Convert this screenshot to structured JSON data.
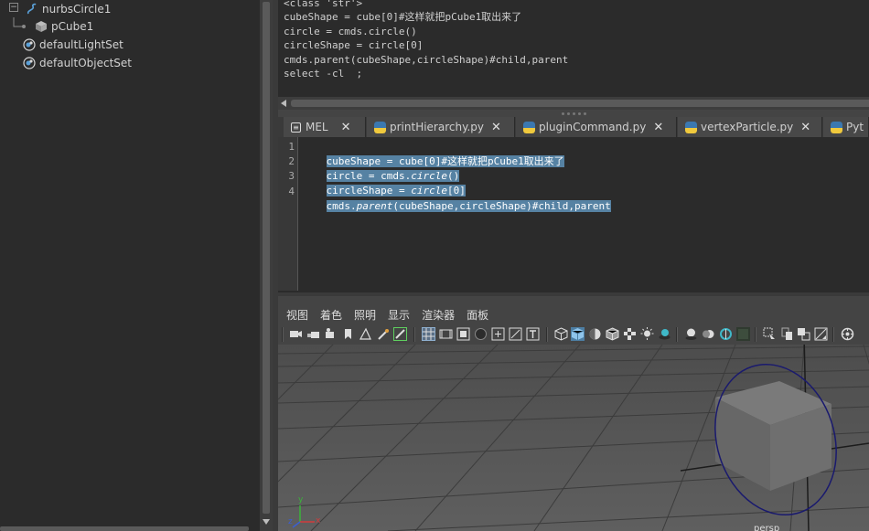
{
  "outliner": {
    "items": [
      {
        "label": "nurbsCircle1",
        "icon": "curve-icon"
      },
      {
        "label": "pCube1",
        "icon": "mesh-icon"
      },
      {
        "label": "defaultLightSet",
        "icon": "set-icon"
      },
      {
        "label": "defaultObjectSet",
        "icon": "set-icon"
      }
    ]
  },
  "history": {
    "lines": [
      "<class 'str'>",
      "cubeShape = cube[0]#这样就把pCube1取出来了",
      "circle = cmds.circle()",
      "circleShape = circle[0]",
      "cmds.parent(cubeShape,circleShape)#child,parent",
      "select -cl  ;"
    ]
  },
  "tabs": [
    {
      "label": "MEL",
      "icon": "mel-icon"
    },
    {
      "label": "printHierarchy.py",
      "icon": "python-icon"
    },
    {
      "label": "pluginCommand.py",
      "icon": "python-icon"
    },
    {
      "label": "vertexParticle.py",
      "icon": "python-icon"
    },
    {
      "label": "Pyt",
      "icon": "python-icon"
    }
  ],
  "editor": {
    "line_numbers": [
      "1",
      "2",
      "3",
      "4"
    ],
    "line1": "cubeShape = cube[0]#这样就把pCube1取出来了",
    "line2_a": "circle = cmds.",
    "line2_b": "circle",
    "line2_c": "()",
    "line3_a": "circleShape = ",
    "line3_b": "circle",
    "line3_c": "[0]",
    "line4_a": "cmds.",
    "line4_b": "parent",
    "line4_c": "(cubeShape,circleShape)#child,parent"
  },
  "viewport": {
    "menus": [
      "视图",
      "着色",
      "照明",
      "显示",
      "渲染器",
      "面板"
    ],
    "camera_label": "persp",
    "axis_labels": {
      "x": "x",
      "y": "y",
      "z": "z"
    },
    "colors": {
      "selection": "#5682a3",
      "curve": "#1a1a6e",
      "axis_x": "#d23b3b",
      "axis_y": "#3bb33b",
      "axis_z": "#3b5fd2"
    }
  }
}
